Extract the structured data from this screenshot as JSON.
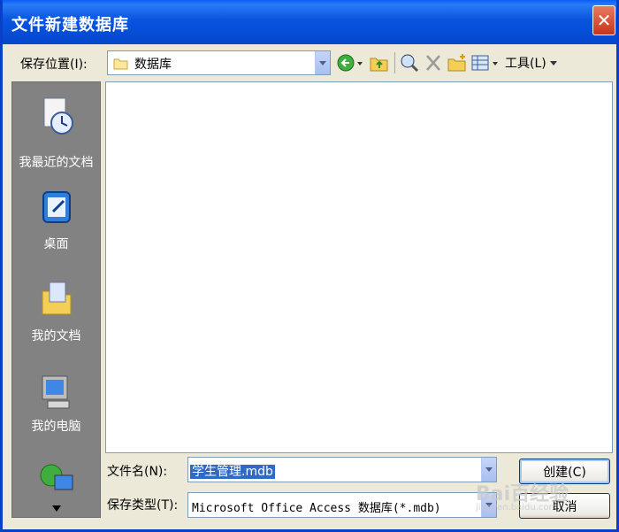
{
  "window": {
    "title": "文件新建数据库",
    "close_glyph": "✕"
  },
  "toolbar": {
    "save_in_label": "保存位置(I):",
    "save_in_value": "数据库",
    "tools_label": "工具(L)"
  },
  "places": [
    {
      "label": "我最近的文档",
      "icon": "recent-documents-icon"
    },
    {
      "label": "桌面",
      "icon": "desktop-icon"
    },
    {
      "label": "我的文档",
      "icon": "my-documents-icon"
    },
    {
      "label": "我的电脑",
      "icon": "my-computer-icon"
    },
    {
      "label": "",
      "icon": "network-places-icon"
    }
  ],
  "form": {
    "filename_label": "文件名(N):",
    "filename_value": "学生管理.mdb",
    "filetype_label": "保存类型(T):",
    "filetype_value": "Microsoft Office Access 数据库(*.mdb)",
    "create_button": "创建(C)",
    "cancel_button": "取消"
  },
  "watermark": {
    "text": "Bai百经验",
    "sub": "jingyan.baidu.com"
  },
  "colors": {
    "title_blue": "#0854e0",
    "places_gray": "#828282",
    "face": "#ece9d8",
    "selection": "#316ac5"
  }
}
